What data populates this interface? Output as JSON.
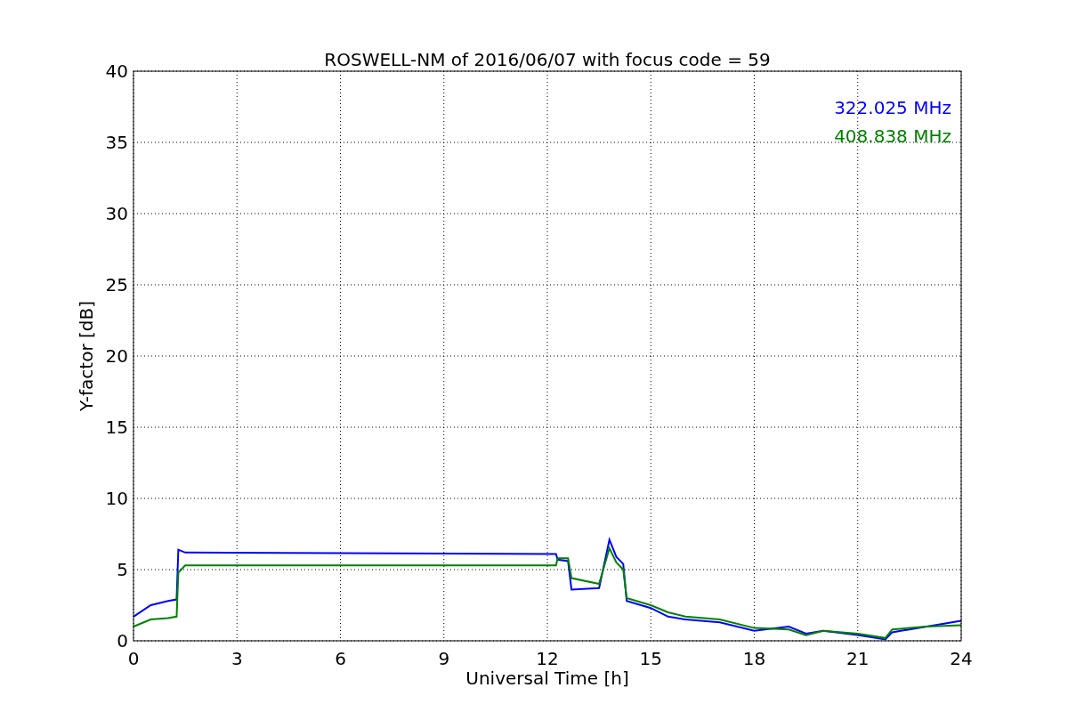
{
  "chart_data": {
    "type": "line",
    "title": "ROSWELL-NM of 2016/06/07 with focus code = 59",
    "xlabel": "Universal Time [h]",
    "ylabel": "Y-factor [dB]",
    "x": [
      0,
      0.5,
      1,
      1.25,
      1.3,
      1.5,
      12.25,
      12.3,
      12.6,
      12.7,
      13.5,
      13.8,
      14,
      14.2,
      14.3,
      15,
      15.5,
      16,
      17,
      18,
      19,
      19.5,
      20,
      21,
      21.8,
      22,
      23,
      24
    ],
    "series": [
      {
        "name": "322.025 MHz",
        "color": "#0000ff",
        "values": [
          1.7,
          2.5,
          2.8,
          2.9,
          6.4,
          6.2,
          6.1,
          5.7,
          5.6,
          3.6,
          3.7,
          7.1,
          5.9,
          5.4,
          2.8,
          2.3,
          1.7,
          1.5,
          1.3,
          0.7,
          1.0,
          0.5,
          0.7,
          0.4,
          0.1,
          0.6,
          1.0,
          1.4
        ]
      },
      {
        "name": "408.838 MHz",
        "color": "#008000",
        "values": [
          1.0,
          1.5,
          1.6,
          1.7,
          4.8,
          5.3,
          5.3,
          5.8,
          5.8,
          4.4,
          4.0,
          6.5,
          5.5,
          5.0,
          3.0,
          2.5,
          2.0,
          1.7,
          1.5,
          0.9,
          0.8,
          0.4,
          0.7,
          0.5,
          0.2,
          0.8,
          1.0,
          1.1
        ]
      }
    ],
    "xlim": [
      0,
      24
    ],
    "ylim": [
      0,
      40
    ],
    "xticks": [
      0,
      3,
      6,
      9,
      12,
      15,
      18,
      21,
      24
    ],
    "yticks": [
      0,
      5,
      10,
      15,
      20,
      25,
      30,
      35,
      40
    ],
    "grid": true
  }
}
